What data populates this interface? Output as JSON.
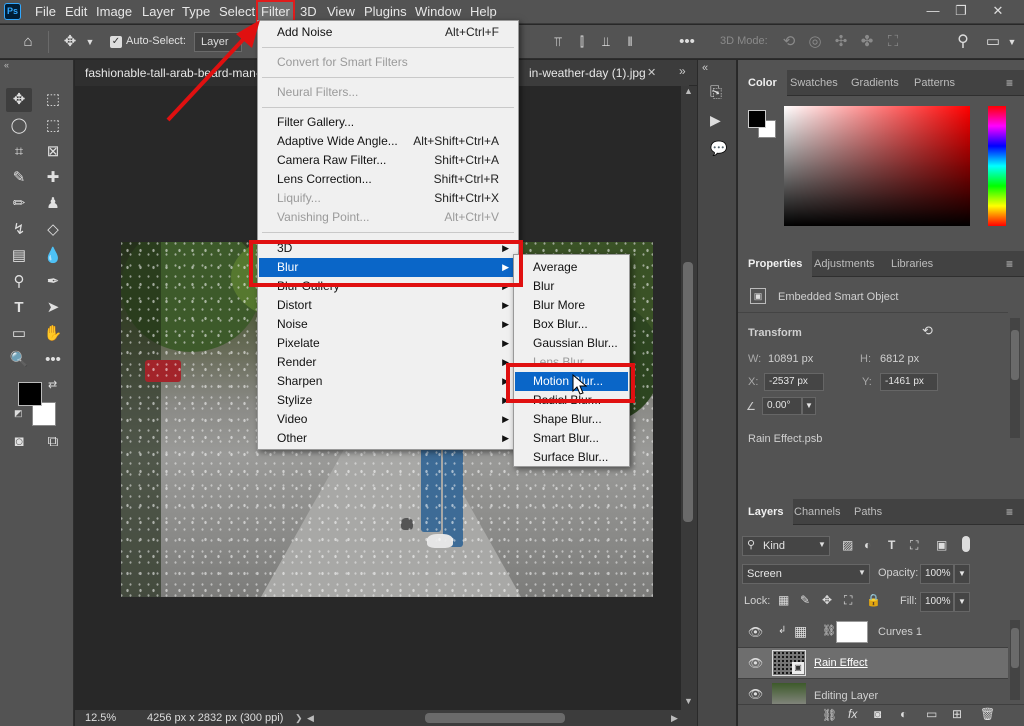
{
  "menubar": {
    "items": [
      "File",
      "Edit",
      "Image",
      "Layer",
      "Type",
      "Select",
      "Filter",
      "3D",
      "View",
      "Plugins",
      "Window",
      "Help"
    ],
    "active": "Filter"
  },
  "app_logo": "Ps",
  "options": {
    "auto_select_label": "Auto-Select:",
    "auto_select_value": "Layer",
    "mode_3d_label": "3D Mode:"
  },
  "doc_tabs": {
    "tab1": "fashionable-tall-arab-beard-man-",
    "tab2": "in-weather-day (1).jpg"
  },
  "status": {
    "zoom": "12.5%",
    "doc_info": "4256 px x 2832 px (300 ppi)"
  },
  "filter_menu": {
    "add_noise": {
      "label": "Add Noise",
      "shortcut": "Alt+Ctrl+F"
    },
    "convert": "Convert for Smart Filters",
    "neural": "Neural Filters...",
    "filter_gallery": "Filter Gallery...",
    "adaptive": {
      "label": "Adaptive Wide Angle...",
      "shortcut": "Alt+Shift+Ctrl+A"
    },
    "camera_raw": {
      "label": "Camera Raw Filter...",
      "shortcut": "Shift+Ctrl+A"
    },
    "lens_correction": {
      "label": "Lens Correction...",
      "shortcut": "Shift+Ctrl+R"
    },
    "liquify": {
      "label": "Liquify...",
      "shortcut": "Shift+Ctrl+X"
    },
    "vanishing": {
      "label": "Vanishing Point...",
      "shortcut": "Alt+Ctrl+V"
    },
    "groups": [
      "3D",
      "Blur",
      "Blur Gallery",
      "Distort",
      "Noise",
      "Pixelate",
      "Render",
      "Sharpen",
      "Stylize",
      "Video",
      "Other"
    ],
    "highlighted": "Blur"
  },
  "blur_submenu": {
    "items": [
      "Average",
      "Blur",
      "Blur More",
      "Box Blur...",
      "Gaussian Blur...",
      "Lens Blur...",
      "Motion Blur...",
      "Radial Blur...",
      "Shape Blur...",
      "Smart Blur...",
      "Surface Blur..."
    ],
    "highlighted": "Motion Blur..."
  },
  "color_panel": {
    "tabs": [
      "Color",
      "Swatches",
      "Gradients",
      "Patterns"
    ]
  },
  "properties_panel": {
    "tabs": [
      "Properties",
      "Adjustments",
      "Libraries"
    ],
    "object_type": "Embedded Smart Object",
    "transform_label": "Transform",
    "w_label": "W:",
    "w_value": "10891 px",
    "h_label": "H:",
    "h_value": "6812 px",
    "x_label": "X:",
    "x_value": "-2537 px",
    "y_label": "Y:",
    "y_value": "-1461 px",
    "angle_value": "0.00°",
    "linked_file": "Rain Effect.psb"
  },
  "layers_panel": {
    "tabs": [
      "Layers",
      "Channels",
      "Paths"
    ],
    "filter_kind": "Kind",
    "blend_mode": "Screen",
    "opacity_label": "Opacity:",
    "opacity_value": "100%",
    "lock_label": "Lock:",
    "fill_label": "Fill:",
    "fill_value": "100%",
    "layers": [
      "Curves 1",
      "Rain Effect",
      "Editing Layer"
    ]
  },
  "colors": {
    "accent": "#0a66c8",
    "highlight": "#e01010",
    "ui_bg": "#535353"
  }
}
